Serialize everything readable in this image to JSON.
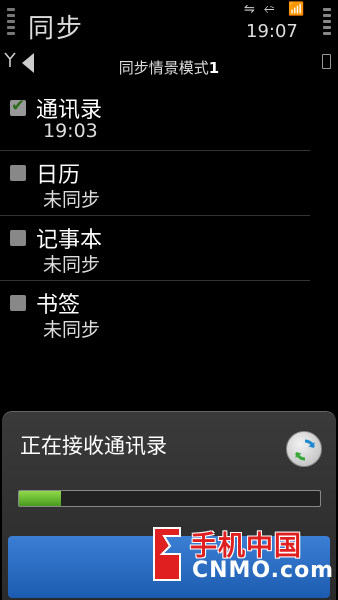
{
  "status_bar": {
    "app_title": "同步",
    "time": "19:07",
    "icons": [
      "sync-status-icon",
      "usb-icon",
      "signal-lock-icon"
    ]
  },
  "nav": {
    "profile_name": "同步情景模式",
    "profile_number": "1"
  },
  "items": [
    {
      "title": "通讯录",
      "status": "19:03",
      "checked": true
    },
    {
      "title": "日历",
      "status": "未同步",
      "checked": false
    },
    {
      "title": "记事本",
      "status": "未同步",
      "checked": false
    },
    {
      "title": "书签",
      "status": "未同步",
      "checked": false
    }
  ],
  "dialog": {
    "message": "正在接收通讯录",
    "progress_fraction": 0.14
  },
  "watermark": {
    "cn": "手机中国",
    "en": "CNMO.com"
  },
  "colors": {
    "progress_fill": "#6fc23a",
    "button_blue": "#2a6cc4",
    "watermark_red": "#e02020"
  }
}
